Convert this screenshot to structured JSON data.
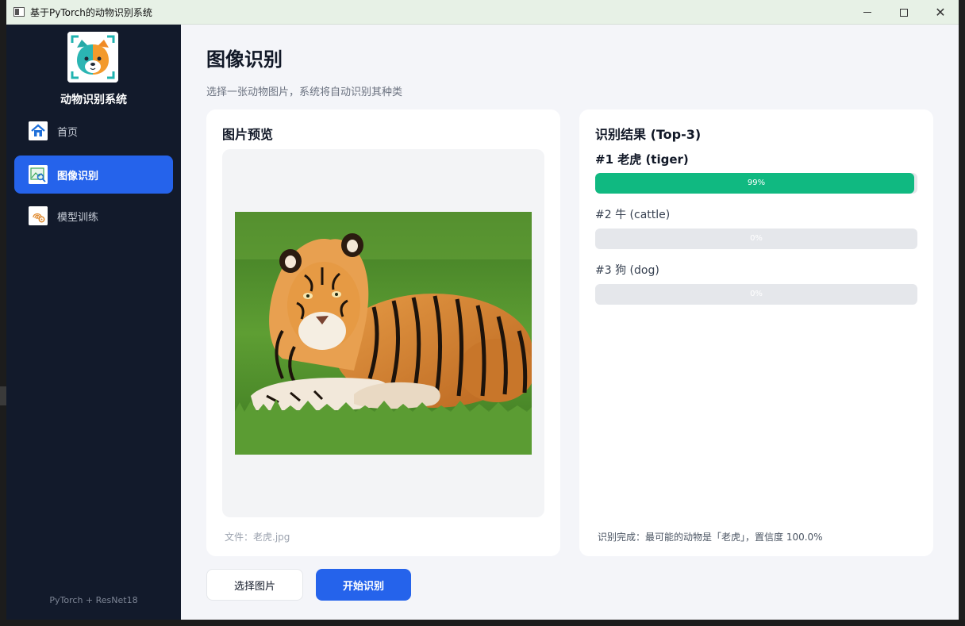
{
  "window": {
    "title": "基于PyTorch的动物识别系统",
    "close_glyph": "✕"
  },
  "sidebar": {
    "brand": "动物识别系统",
    "footer": "PyTorch + ResNet18",
    "items": [
      {
        "label": "首页",
        "icon": "home-icon"
      },
      {
        "label": "图像识别",
        "icon": "image-search-icon",
        "active": true
      },
      {
        "label": "模型训练",
        "icon": "fingerprint-gear-icon"
      }
    ]
  },
  "main": {
    "title": "图像识别",
    "subtitle": "选择一张动物图片，系统将自动识别其种类",
    "preview": {
      "title": "图片预览",
      "file_label": "文件：老虎.jpg"
    },
    "results": {
      "title": "识别结果 (Top-3)",
      "items": [
        {
          "label": "#1  老虎 (tiger)",
          "percent_text": "99%",
          "percent": 99
        },
        {
          "label": "#2  牛 (cattle)",
          "percent_text": "0%",
          "percent": 0
        },
        {
          "label": "#3  狗 (dog)",
          "percent_text": "0%",
          "percent": 0
        }
      ],
      "status": "识别完成：最可能的动物是「老虎」，置信度 100.0%"
    },
    "buttons": {
      "select": "选择图片",
      "start": "开始识别"
    }
  },
  "colors": {
    "sidebar_bg": "#121a2b",
    "accent": "#2563eb",
    "bar_fill": "#10b981",
    "bar_track": "#e5e7eb"
  }
}
